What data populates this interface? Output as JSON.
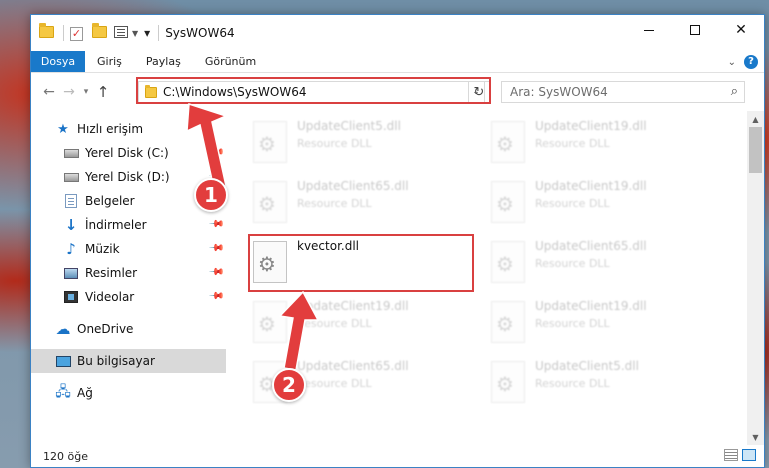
{
  "window": {
    "title": "SysWOW64",
    "controls": {
      "minimize": "minimize-icon",
      "maximize": "maximize-icon",
      "close": "✕"
    }
  },
  "ribbon": {
    "tabs": [
      "Dosya",
      "Giriş",
      "Paylaş",
      "Görünüm"
    ],
    "help": "?"
  },
  "address": {
    "path": "C:\\Windows\\SysWOW64",
    "search_placeholder": "Ara: SysWOW64"
  },
  "nav": {
    "quick_access": "Hızlı erişim",
    "items": [
      {
        "label": "Yerel Disk (C:)",
        "icon": "drive-icon",
        "pinned": true
      },
      {
        "label": "Yerel Disk (D:)",
        "icon": "drive-icon",
        "pinned": true
      },
      {
        "label": "Belgeler",
        "icon": "documents-icon",
        "pinned": true
      },
      {
        "label": "İndirmeler",
        "icon": "download-icon",
        "pinned": true
      },
      {
        "label": "Müzik",
        "icon": "music-icon",
        "pinned": true
      },
      {
        "label": "Resimler",
        "icon": "pictures-icon",
        "pinned": true
      },
      {
        "label": "Videolar",
        "icon": "videos-icon",
        "pinned": true
      }
    ],
    "onedrive": "OneDrive",
    "this_pc": "Bu bilgisayar",
    "network": "Ağ"
  },
  "files": [
    {
      "name": "UpdateClient5.dll",
      "type": "Resource DLL",
      "blurred": true
    },
    {
      "name": "UpdateClient19.dll",
      "type": "Resource DLL",
      "blurred": true
    },
    {
      "name": "UpdateClient65.dll",
      "type": "Resource DLL",
      "blurred": true
    },
    {
      "name": "UpdateClient19.dll",
      "type": "Resource DLL",
      "blurred": true
    },
    {
      "name": "kvector.dll",
      "type": "",
      "blurred": false
    },
    {
      "name": "UpdateClient65.dll",
      "type": "Resource DLL",
      "blurred": true
    },
    {
      "name": "UpdateClient19.dll",
      "type": "Resource DLL",
      "blurred": true
    },
    {
      "name": "UpdateClient19.dll",
      "type": "Resource DLL",
      "blurred": true
    },
    {
      "name": "UpdateClient65.dll",
      "type": "Resource DLL",
      "blurred": true
    },
    {
      "name": "UpdateClient5.dll",
      "type": "Resource DLL",
      "blurred": true
    }
  ],
  "status": {
    "count": "120 öğe"
  },
  "annotations": {
    "step1": "1",
    "step2": "2",
    "color": "#e23d3d"
  }
}
